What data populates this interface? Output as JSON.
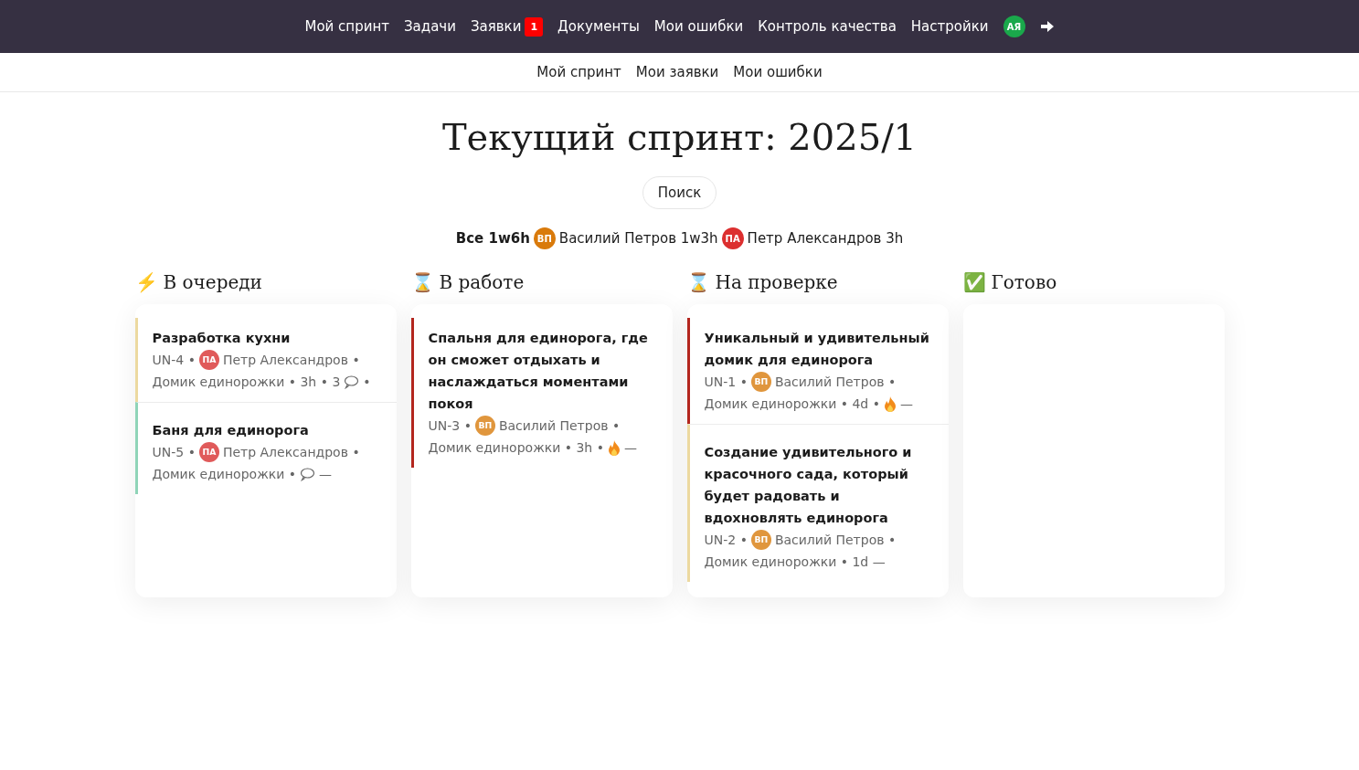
{
  "nav": {
    "items": [
      {
        "label": "Мой спринт"
      },
      {
        "label": "Задачи"
      },
      {
        "label": "Заявки",
        "badge": "1"
      },
      {
        "label": "Документы"
      },
      {
        "label": "Мои ошибки"
      },
      {
        "label": "Контроль качества"
      },
      {
        "label": "Настройки"
      }
    ],
    "user": {
      "initials": "АЯ",
      "color": "#1aa84b"
    }
  },
  "subnav": [
    "Мой спринт",
    "Мои заявки",
    "Мои ошибки"
  ],
  "title": "Текущий спринт: 2025/1",
  "search_button": "Поиск",
  "summary": {
    "total": "Все 1w6h",
    "people": [
      {
        "initials": "ВП",
        "color": "#d97a0b",
        "text": "Василий Петров 1w3h"
      },
      {
        "initials": "ПА",
        "color": "#dc2f2f",
        "text": "Петр Александров 3h"
      }
    ]
  },
  "columns": [
    {
      "icon": "⚡",
      "title": "В очереди",
      "cards": [
        {
          "title": "Разработка кухни",
          "color": "#ecd9a0",
          "meta": [
            {
              "kind": "text",
              "text": "UN-4 •"
            },
            {
              "kind": "avatar",
              "initials": "ПА",
              "color": "#e05a5a"
            },
            {
              "kind": "text",
              "text": "Петр Александров •"
            },
            {
              "kind": "text",
              "text": "Домик единорожки • 3h • 3"
            },
            {
              "kind": "comment"
            },
            {
              "kind": "text",
              "text": "•"
            }
          ]
        },
        {
          "title": "Баня для единорога",
          "color": "#8fd4b8",
          "meta": [
            {
              "kind": "text",
              "text": "UN-5 •"
            },
            {
              "kind": "avatar",
              "initials": "ПА",
              "color": "#e05a5a"
            },
            {
              "kind": "text",
              "text": "Петр Александров •"
            },
            {
              "kind": "text",
              "text": "Домик единорожки •"
            },
            {
              "kind": "comment"
            },
            {
              "kind": "text",
              "text": "—"
            }
          ]
        }
      ]
    },
    {
      "icon": "⌛",
      "title": "В работе",
      "cards": [
        {
          "title": "Спальня для единорога, где он сможет отдыхать и наслаждаться моментами покоя",
          "color": "#b3261e",
          "meta": [
            {
              "kind": "text",
              "text": "UN-3 •"
            },
            {
              "kind": "avatar",
              "initials": "ВП",
              "color": "#e0963d"
            },
            {
              "kind": "text",
              "text": "Василий Петров •"
            },
            {
              "kind": "text",
              "text": "Домик единорожки • 3h •"
            },
            {
              "kind": "fire"
            },
            {
              "kind": "text",
              "text": "—"
            }
          ]
        }
      ]
    },
    {
      "icon": "⌛",
      "title": "На проверке",
      "cards": [
        {
          "title": "Уникальный и удивительный домик для единорога",
          "color": "#b3261e",
          "meta": [
            {
              "kind": "text",
              "text": "UN-1 •"
            },
            {
              "kind": "avatar",
              "initials": "ВП",
              "color": "#e0963d"
            },
            {
              "kind": "text",
              "text": "Василий Петров •"
            },
            {
              "kind": "text",
              "text": "Домик единорожки • 4d •"
            },
            {
              "kind": "fire"
            },
            {
              "kind": "text",
              "text": "—"
            }
          ]
        },
        {
          "title": "Создание удивительного и красочного сада, который будет радовать и вдохновлять единорога",
          "color": "#ecd9a0",
          "meta": [
            {
              "kind": "text",
              "text": "UN-2 •"
            },
            {
              "kind": "avatar",
              "initials": "ВП",
              "color": "#e0963d"
            },
            {
              "kind": "text",
              "text": "Василий Петров •"
            },
            {
              "kind": "text",
              "text": "Домик единорожки • 1d —"
            }
          ]
        }
      ]
    },
    {
      "icon": "✅",
      "title": "Готово"
    }
  ]
}
